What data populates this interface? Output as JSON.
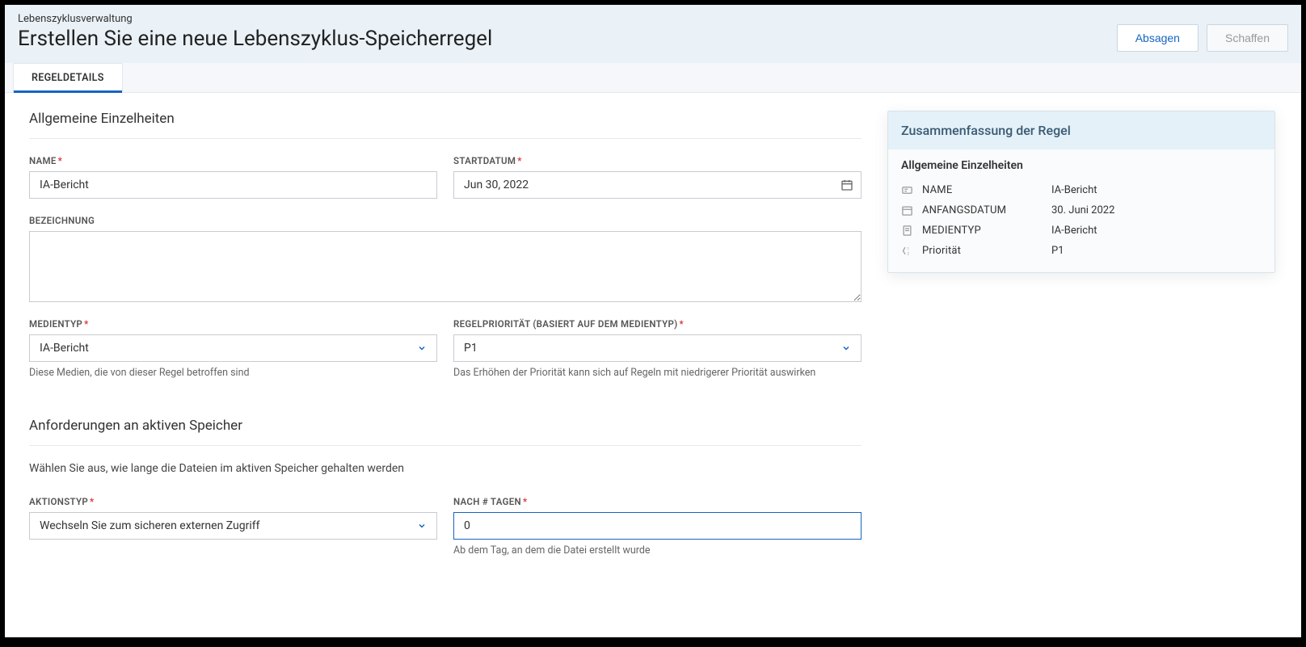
{
  "header": {
    "breadcrumb": "Lebenszyklusverwaltung",
    "title": "Erstellen Sie eine neue Lebenszyklus-Speicherregel",
    "cancel": "Absagen",
    "create": "Schaffen"
  },
  "tabs": {
    "details": "REGELDETAILS"
  },
  "section1": {
    "title": "Allgemeine Einzelheiten",
    "name_label": "NAME",
    "name_value": "IA-Bericht",
    "startdate_label": "STARTDATUM",
    "startdate_value": "Jun 30, 2022",
    "desc_label": "BEZEICHNUNG",
    "desc_value": "",
    "mediatype_label": "MEDIENTYP",
    "mediatype_value": "IA-Bericht",
    "mediatype_helper": "Diese Medien, die von dieser Regel betroffen sind",
    "priority_label": "REGELPRIORITÄT (BASIERT AUF DEM MEDIENTYP)",
    "priority_value": "P1",
    "priority_helper": "Das Erhöhen der Priorität kann sich auf Regeln mit niedrigerer Priorität auswirken"
  },
  "section2": {
    "title": "Anforderungen an aktiven Speicher",
    "intro": "Wählen Sie aus, wie lange die Dateien im aktiven Speicher gehalten werden",
    "action_label": "AKTIONSTYP",
    "action_value": "Wechseln Sie zum sicheren externen Zugriff",
    "days_label": "NACH # TAGEN",
    "days_value": "0",
    "days_helper": "Ab dem Tag, an dem die Datei erstellt wurde"
  },
  "summary": {
    "title": "Zusammenfassung der Regel",
    "subtitle": "Allgemeine Einzelheiten",
    "rows": [
      {
        "label": "NAME",
        "value": "IA-Bericht"
      },
      {
        "label": "ANFANGSDATUM",
        "value": "30. Juni 2022"
      },
      {
        "label": "MEDIENTYP",
        "value": "IA-Bericht"
      },
      {
        "label": "Priorität",
        "value": "P1"
      }
    ]
  }
}
